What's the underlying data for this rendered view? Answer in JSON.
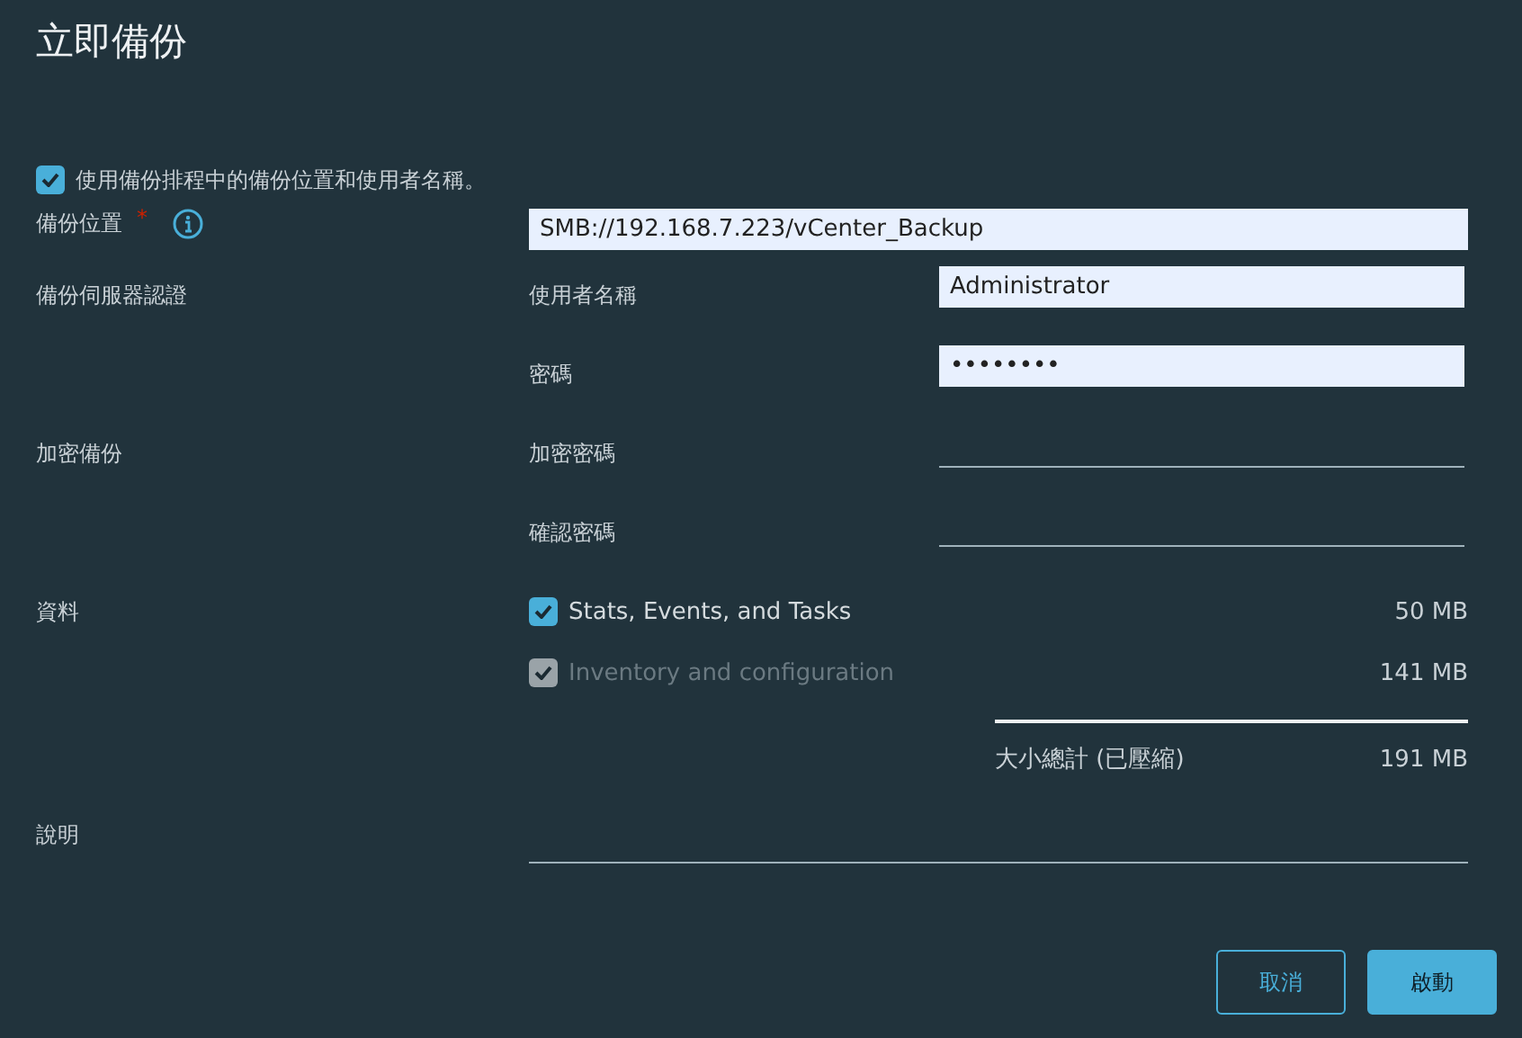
{
  "dialog": {
    "title": "立即備份"
  },
  "use_schedule": {
    "label": "使用備份排程中的備份位置和使用者名稱。",
    "checked": true
  },
  "location": {
    "label": "備份位置",
    "required_mark": "*",
    "value": "SMB://192.168.7.223/vCenter_Backup"
  },
  "auth": {
    "label": "備份伺服器認證",
    "fields": [
      {
        "label": "使用者名稱",
        "value": "Administrator"
      },
      {
        "label": "密碼",
        "value": "••••••••"
      }
    ]
  },
  "encryption": {
    "label": "加密備份",
    "fields": [
      {
        "label": "加密密碼"
      },
      {
        "label": "確認密碼"
      }
    ]
  },
  "data": {
    "label": "資料",
    "items": [
      {
        "label": "Stats, Events, and Tasks",
        "size": "50 MB",
        "checked": true,
        "disabled": false
      },
      {
        "label": "Inventory and configuration",
        "size": "141 MB",
        "checked": true,
        "disabled": true
      }
    ],
    "total_label": "大小總計 (已壓縮)",
    "total": "191 MB"
  },
  "description": {
    "label": "說明"
  },
  "buttons": [
    {
      "label": "取消",
      "kind": "secondary"
    },
    {
      "label": "啟動",
      "kind": "primary"
    }
  ]
}
